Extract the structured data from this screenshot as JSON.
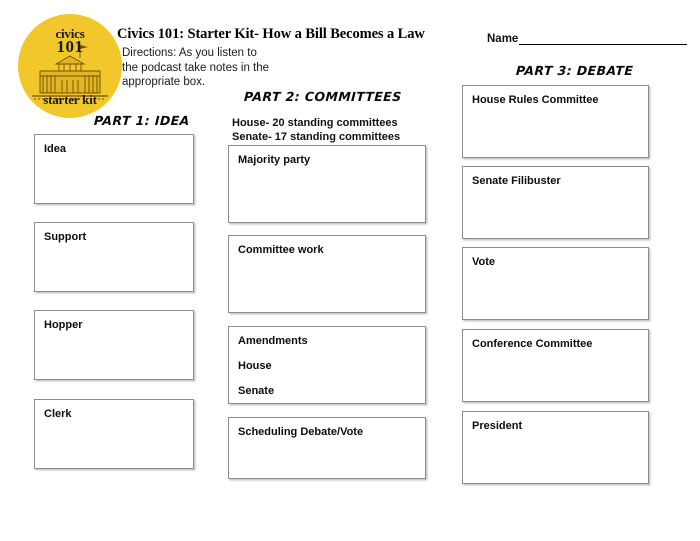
{
  "header": {
    "title": "Civics 101: Starter Kit- How a Bill Becomes a Law",
    "directions": "Directions: As you listen to the podcast take notes in the appropriate box.",
    "name_label": "Name"
  },
  "logo": {
    "text_top_small": "civics",
    "text_top_big": "101",
    "text_bottom": "starter kit",
    "color": "#F2C72B",
    "illustration": "white-house-illustration"
  },
  "parts": {
    "part1": {
      "heading": "Part 1: Idea",
      "boxes": [
        {
          "label": "Idea"
        },
        {
          "label": "Support"
        },
        {
          "label": "Hopper"
        },
        {
          "label": "Clerk"
        }
      ]
    },
    "part2": {
      "heading": "Part 2: Committees",
      "note_house": "House- 20 standing committees",
      "note_senate": "Senate- 17 standing committees",
      "boxes": [
        {
          "label": "Majority party"
        },
        {
          "label": "Committee work"
        },
        {
          "label": "Amendments",
          "label2": "House",
          "label3": "Senate"
        },
        {
          "label": "Scheduling Debate/Vote"
        }
      ]
    },
    "part3": {
      "heading": "Part 3: Debate",
      "boxes": [
        {
          "label": "House Rules Committee"
        },
        {
          "label": "Senate Filibuster"
        },
        {
          "label": "Vote"
        },
        {
          "label": "Conference Committee"
        },
        {
          "label": "President"
        }
      ]
    }
  }
}
